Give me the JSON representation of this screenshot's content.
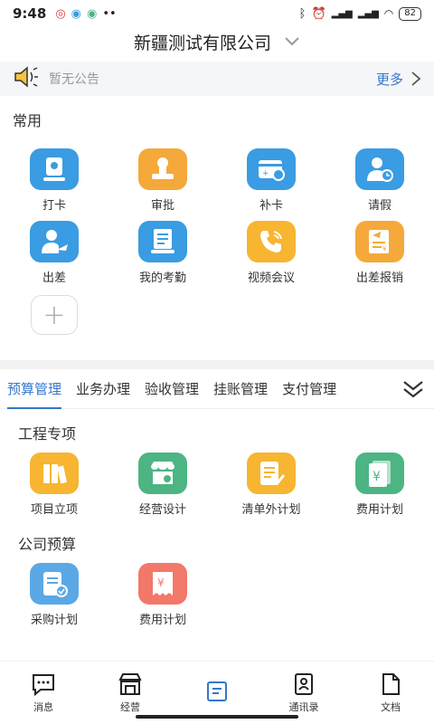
{
  "status": {
    "time": "9:48",
    "battery": "82"
  },
  "header": {
    "title": "新疆测试有限公司"
  },
  "notice": {
    "text": "暂无公告",
    "more": "更多"
  },
  "common": {
    "title": "常用",
    "items": [
      {
        "label": "打卡",
        "icon": "attendance-icon",
        "color": "#3a9ce2"
      },
      {
        "label": "审批",
        "icon": "approval-stamp-icon",
        "color": "#f4a93a"
      },
      {
        "label": "补卡",
        "icon": "card-refill-icon",
        "color": "#3a9ce2"
      },
      {
        "label": "请假",
        "icon": "leave-clock-icon",
        "color": "#3a9ce2"
      },
      {
        "label": "出差",
        "icon": "business-trip-icon",
        "color": "#3a9ce2"
      },
      {
        "label": "我的考勤",
        "icon": "my-attendance-icon",
        "color": "#3a9ce2"
      },
      {
        "label": "视频会议",
        "icon": "video-call-icon",
        "color": "#f7b531"
      },
      {
        "label": "出差报销",
        "icon": "reimbursement-icon",
        "color": "#f4a93a"
      }
    ]
  },
  "tabs": [
    "预算管理",
    "业务办理",
    "验收管理",
    "挂账管理",
    "支付管理"
  ],
  "engineering": {
    "title": "工程专项",
    "items": [
      {
        "label": "项目立项",
        "icon": "project-init-icon",
        "color": "#f7b531"
      },
      {
        "label": "经营设计",
        "icon": "store-design-icon",
        "color": "#4cb583"
      },
      {
        "label": "清单外计划",
        "icon": "doc-edit-icon",
        "color": "#f7b531"
      },
      {
        "label": "费用计划",
        "icon": "cost-plan-icon",
        "color": "#4cb583"
      }
    ]
  },
  "company_budget": {
    "title": "公司预算",
    "items": [
      {
        "label": "采购计划",
        "icon": "purchase-plan-icon",
        "color": "#5aa8e6"
      },
      {
        "label": "费用计划",
        "icon": "receipt-icon",
        "color": "#f2786a"
      }
    ]
  },
  "nav": [
    {
      "label": "消息",
      "icon": "message-icon"
    },
    {
      "label": "经营",
      "icon": "shop-icon"
    },
    {
      "label": "",
      "icon": "workbench-icon"
    },
    {
      "label": "通讯录",
      "icon": "contacts-icon"
    },
    {
      "label": "文档",
      "icon": "document-icon"
    }
  ]
}
